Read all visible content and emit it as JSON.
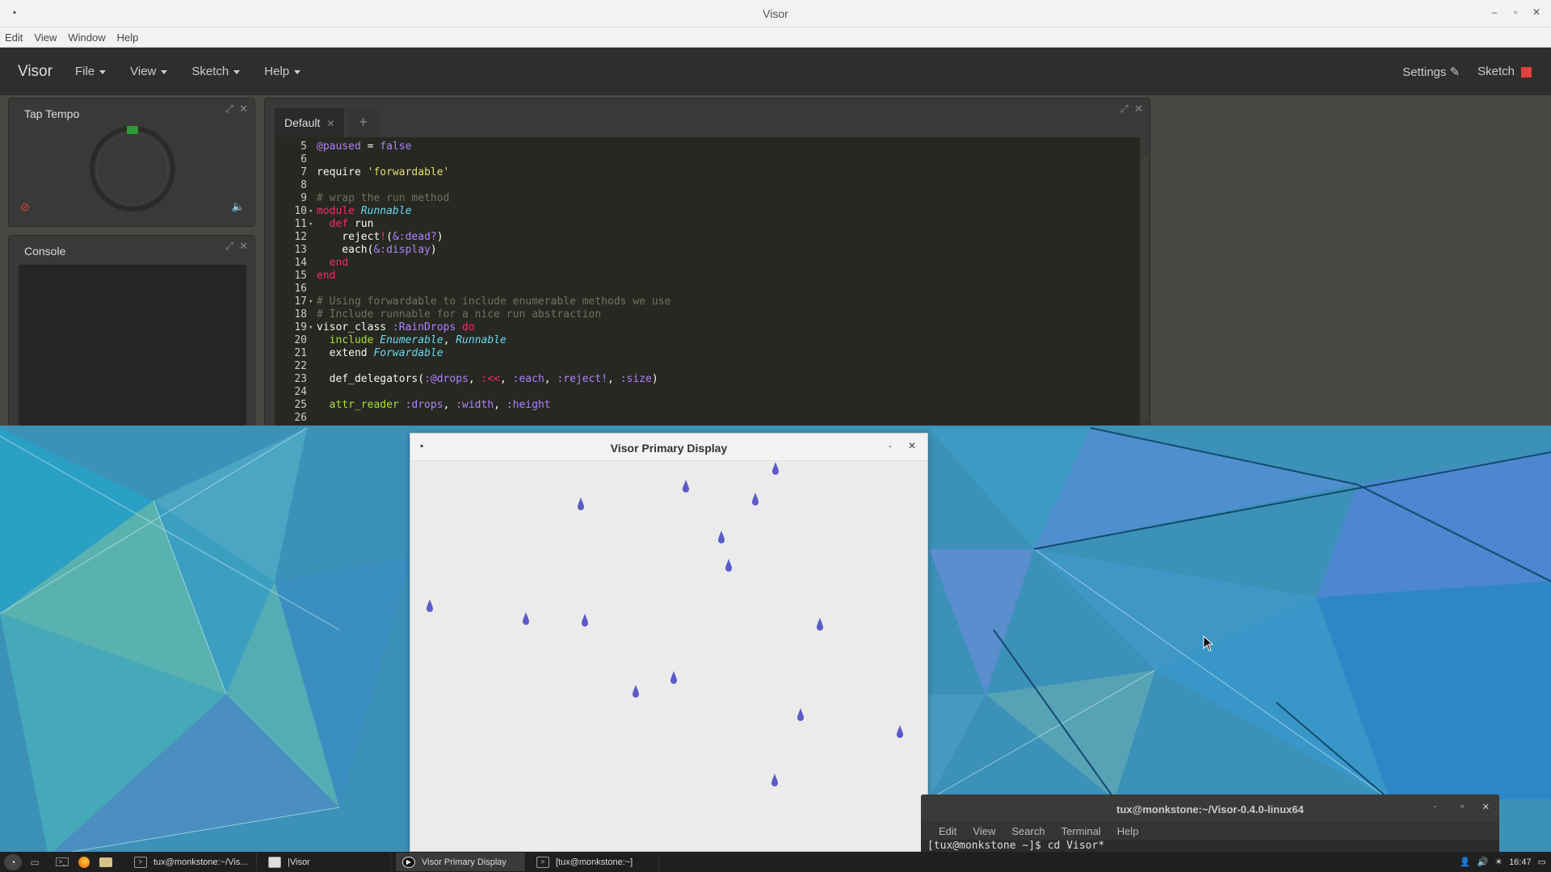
{
  "visor_window": {
    "title": "Visor",
    "menubar": [
      "Edit",
      "View",
      "Window",
      "Help"
    ],
    "brand": "Visor",
    "nav": [
      {
        "label": "File"
      },
      {
        "label": "View"
      },
      {
        "label": "Sketch"
      },
      {
        "label": "Help"
      }
    ],
    "settings_label": "Settings",
    "sketch_label": "Sketch",
    "colors": {
      "stop": "#e04040",
      "beat": "#2e9a35"
    }
  },
  "tap_tempo": {
    "title": "Tap Tempo"
  },
  "console": {
    "title": "Console"
  },
  "editor": {
    "tab_label": "Default",
    "tab_close": "✕",
    "add_tab": "+",
    "lines": [
      {
        "n": "5",
        "fold": "",
        "tokens": [
          [
            "@paused",
            "tk-sym"
          ],
          [
            " = ",
            "tk-plain"
          ],
          [
            "false",
            "tk-sym"
          ]
        ]
      },
      {
        "n": "6",
        "fold": "",
        "tokens": []
      },
      {
        "n": "7",
        "fold": "",
        "tokens": [
          [
            "require ",
            "tk-plain"
          ],
          [
            "'forwardable'",
            "tk-str"
          ]
        ]
      },
      {
        "n": "8",
        "fold": "",
        "tokens": []
      },
      {
        "n": "9",
        "fold": "",
        "tokens": [
          [
            "# wrap the run method",
            "tk-com"
          ]
        ]
      },
      {
        "n": "10",
        "fold": "▾",
        "tokens": [
          [
            "module ",
            "tk-kw"
          ],
          [
            "Runnable",
            "tk-cls"
          ]
        ]
      },
      {
        "n": "11",
        "fold": "▾",
        "tokens": [
          [
            "  def ",
            "tk-kw"
          ],
          [
            "run",
            "tk-plain"
          ]
        ]
      },
      {
        "n": "12",
        "fold": "",
        "tokens": [
          [
            "    reject",
            "tk-plain"
          ],
          [
            "!",
            "tk-kw"
          ],
          [
            "(",
            "tk-plain"
          ],
          [
            "&:dead?",
            "tk-sym"
          ],
          [
            ")",
            "tk-plain"
          ]
        ]
      },
      {
        "n": "13",
        "fold": "",
        "tokens": [
          [
            "    each(",
            "tk-plain"
          ],
          [
            "&:display",
            "tk-sym"
          ],
          [
            ")",
            "tk-plain"
          ]
        ]
      },
      {
        "n": "14",
        "fold": "",
        "tokens": [
          [
            "  end",
            "tk-kw"
          ]
        ]
      },
      {
        "n": "15",
        "fold": "",
        "tokens": [
          [
            "end",
            "tk-kw"
          ]
        ]
      },
      {
        "n": "16",
        "fold": "",
        "tokens": []
      },
      {
        "n": "17",
        "fold": "▾",
        "tokens": [
          [
            "# Using forwardable to include enumerable methods we use",
            "tk-com"
          ]
        ]
      },
      {
        "n": "18",
        "fold": "",
        "tokens": [
          [
            "# Include runnable for a nice run abstraction",
            "tk-com"
          ]
        ]
      },
      {
        "n": "19",
        "fold": "▾",
        "tokens": [
          [
            "visor_class ",
            "tk-plain"
          ],
          [
            ":RainDrops",
            "tk-sym"
          ],
          [
            " do",
            "tk-kw"
          ]
        ]
      },
      {
        "n": "20",
        "fold": "",
        "tokens": [
          [
            "  include ",
            "tk-fn"
          ],
          [
            "Enumerable",
            "tk-cls"
          ],
          [
            ", ",
            "tk-plain"
          ],
          [
            "Runnable",
            "tk-cls"
          ]
        ]
      },
      {
        "n": "21",
        "fold": "",
        "tokens": [
          [
            "  extend ",
            "tk-plain"
          ],
          [
            "Forwardable",
            "tk-cls"
          ]
        ]
      },
      {
        "n": "22",
        "fold": "",
        "tokens": []
      },
      {
        "n": "23",
        "fold": "",
        "tokens": [
          [
            "  def_delegators(",
            "tk-plain"
          ],
          [
            ":@drops",
            "tk-sym"
          ],
          [
            ", ",
            "tk-plain"
          ],
          [
            ":<<",
            "tk-kw"
          ],
          [
            ", ",
            "tk-plain"
          ],
          [
            ":each",
            "tk-sym"
          ],
          [
            ", ",
            "tk-plain"
          ],
          [
            ":reject!",
            "tk-sym"
          ],
          [
            ", ",
            "tk-plain"
          ],
          [
            ":size",
            "tk-sym"
          ],
          [
            ")",
            "tk-plain"
          ]
        ]
      },
      {
        "n": "24",
        "fold": "",
        "tokens": []
      },
      {
        "n": "25",
        "fold": "",
        "tokens": [
          [
            "  attr_reader ",
            "tk-fn"
          ],
          [
            ":drops",
            "tk-sym"
          ],
          [
            ", ",
            "tk-plain"
          ],
          [
            ":width",
            "tk-sym"
          ],
          [
            ", ",
            "tk-plain"
          ],
          [
            ":height",
            "tk-sym"
          ]
        ]
      },
      {
        "n": "26",
        "fold": "",
        "tokens": []
      }
    ]
  },
  "display_window": {
    "title": "Visor Primary Display",
    "drop_color": "#5b5bc8"
  },
  "terminal": {
    "title": "tux@monkstone:~/Visor-0.4.0-linux64",
    "menu": [
      "Edit",
      "View",
      "Search",
      "Terminal",
      "Help"
    ],
    "line": "[tux@monkstone ~]$ cd Visor*"
  },
  "taskbar": {
    "tasks": [
      {
        "label": "tux@monkstone:~/Vis...",
        "icon": "terminal-icon",
        "active": false
      },
      {
        "label": "|Visor",
        "icon": "window-icon",
        "active": false
      },
      {
        "label": "Visor Primary Display",
        "icon": "play-icon",
        "active": true
      },
      {
        "label": "[tux@monkstone:~]",
        "icon": "terminal-icon",
        "active": false
      }
    ],
    "time": "16:47"
  }
}
